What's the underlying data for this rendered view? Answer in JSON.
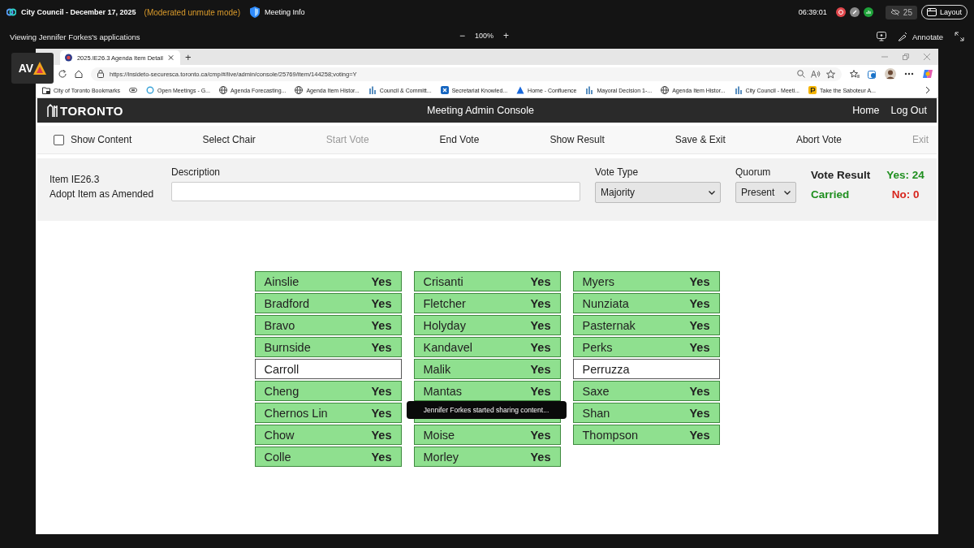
{
  "meeting_bar": {
    "title": "City Council - December 17, 2025",
    "mode": "(Moderated unmute mode)",
    "info_button": "Meeting Info",
    "time": "06:39:01",
    "participants": "25",
    "layout_button": "Layout"
  },
  "share_bar": {
    "viewing": "Viewing Jennifer Forkes's applications",
    "zoom_out": "−",
    "zoom": "100%",
    "zoom_in": "+",
    "annotate": "Annotate"
  },
  "overlay_badge": {
    "text": "AV"
  },
  "browser": {
    "tab": "2025.IE26.3 Agenda Item Detail",
    "new_tab": "+",
    "url": "https://insideto-securesca.toronto.ca/cmp/#/live/admin/console/25769/item/144258;voting=Y",
    "bookmarks": [
      {
        "kind": "folder",
        "label": "City of Toronto Bookmarks"
      },
      {
        "kind": "tag"
      },
      {
        "kind": "o",
        "label": "Open Meetings - G..."
      },
      {
        "kind": "globe",
        "label": "Agenda Forecasting..."
      },
      {
        "kind": "globe",
        "label": "Agenda Item Histor..."
      },
      {
        "kind": "chart",
        "label": "Council & Committ..."
      },
      {
        "kind": "x",
        "label": "Secretariat Knowled..."
      },
      {
        "kind": "peak",
        "label": "Home - Confluence"
      },
      {
        "kind": "chart",
        "label": "Mayoral Decision 1-..."
      },
      {
        "kind": "globe",
        "label": "Agenda Item Histor..."
      },
      {
        "kind": "chart",
        "label": "City Council - Meeti..."
      },
      {
        "kind": "p",
        "label": "Take the Saboteur A..."
      }
    ]
  },
  "console": {
    "logo": "TORONTO",
    "title": "Meeting Admin Console",
    "nav": [
      "Home",
      "Log Out"
    ],
    "toolbar": [
      {
        "kind": "checkbox",
        "label": "Show Content",
        "checked": false
      },
      {
        "kind": "action",
        "label": "Select Chair",
        "disabled": false
      },
      {
        "kind": "action",
        "label": "Start Vote",
        "disabled": true
      },
      {
        "kind": "action",
        "label": "End Vote",
        "disabled": false
      },
      {
        "kind": "action",
        "label": "Show Result",
        "disabled": false
      },
      {
        "kind": "action",
        "label": "Save & Exit",
        "disabled": false
      },
      {
        "kind": "action",
        "label": "Abort Vote",
        "disabled": false
      },
      {
        "kind": "action",
        "label": "Exit",
        "disabled": true
      }
    ],
    "item": {
      "number": "Item IE26.3",
      "title": "Adopt Item as Amended",
      "description_label": "Description",
      "vote_type_label": "Vote Type",
      "vote_type": "Majority",
      "quorum_label": "Quorum",
      "quorum": "Present"
    },
    "result": {
      "label": "Vote Result",
      "yes": "Yes: 24",
      "outcome": "Carried",
      "no": "No: 0"
    },
    "columns": [
      [
        {
          "name": "Ainslie",
          "vote": "Yes",
          "voted": true
        },
        {
          "name": "Bradford",
          "vote": "Yes",
          "voted": true
        },
        {
          "name": "Bravo",
          "vote": "Yes",
          "voted": true
        },
        {
          "name": "Burnside",
          "vote": "Yes",
          "voted": true
        },
        {
          "name": "Carroll",
          "voted": false
        },
        {
          "name": "Cheng",
          "vote": "Yes",
          "voted": true
        },
        {
          "name": "Chernos Lin",
          "vote": "Yes",
          "voted": true
        },
        {
          "name": "Chow",
          "vote": "Yes",
          "voted": true
        },
        {
          "name": "Colle",
          "vote": "Yes",
          "voted": true
        }
      ],
      [
        {
          "name": "Crisanti",
          "vote": "Yes",
          "voted": true
        },
        {
          "name": "Fletcher",
          "vote": "Yes",
          "voted": true
        },
        {
          "name": "Holyday",
          "vote": "Yes",
          "voted": true
        },
        {
          "name": "Kandavel",
          "vote": "Yes",
          "voted": true
        },
        {
          "name": "Malik",
          "vote": "Yes",
          "voted": true
        },
        {
          "name": "Mantas",
          "vote": "Yes",
          "voted": true
        },
        {
          "kind": "covered",
          "voted": true
        },
        {
          "name": "Moise",
          "vote": "Yes",
          "voted": true
        },
        {
          "name": "Morley",
          "vote": "Yes",
          "voted": true
        }
      ],
      [
        {
          "name": "Myers",
          "vote": "Yes",
          "voted": true
        },
        {
          "name": "Nunziata",
          "vote": "Yes",
          "voted": true
        },
        {
          "name": "Pasternak",
          "vote": "Yes",
          "voted": true
        },
        {
          "name": "Perks",
          "vote": "Yes",
          "voted": true
        },
        {
          "name": "Perruzza",
          "voted": false
        },
        {
          "name": "Saxe",
          "vote": "Yes",
          "voted": true
        },
        {
          "name": "Shan",
          "vote": "Yes",
          "voted": true
        },
        {
          "name": "Thompson",
          "vote": "Yes",
          "voted": true
        }
      ]
    ],
    "toast": "Jennifer Forkes started sharing content..."
  }
}
